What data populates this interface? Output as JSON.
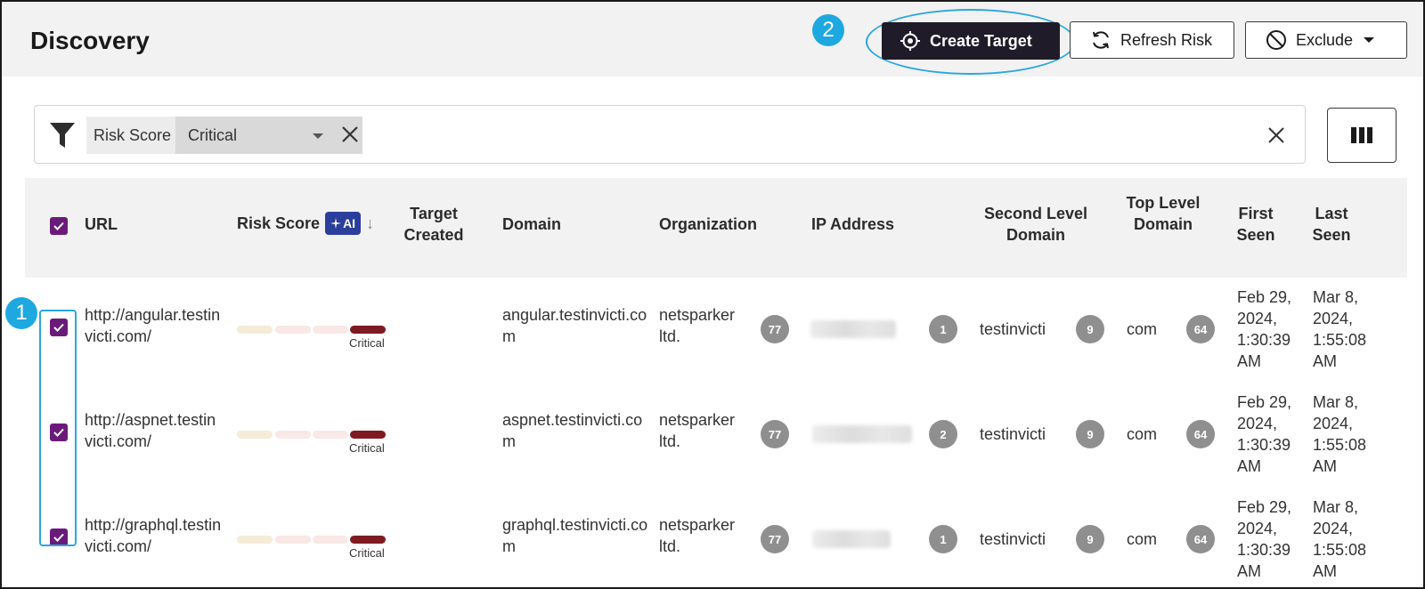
{
  "header": {
    "title": "Discovery",
    "create_target_label": "Create Target",
    "refresh_risk_label": "Refresh Risk",
    "exclude_label": "Exclude"
  },
  "callouts": [
    "1",
    "2"
  ],
  "filter": {
    "field_label": "Risk Score",
    "selected_value": "Critical"
  },
  "table": {
    "columns": {
      "url": "URL",
      "risk_score": "Risk Score",
      "ai_badge": "AI",
      "target_created": "Target Created",
      "domain": "Domain",
      "organization": "Organization",
      "ip_address": "IP Address",
      "second_level_domain": "Second Level Domain",
      "top_level_domain": "Top Level Domain",
      "first_seen": "First Seen",
      "last_seen": "Last Seen"
    },
    "rows": [
      {
        "checked": true,
        "url": "http://angular.testinvicti.com/",
        "risk_level": "Critical",
        "domain": "angular.testinvicti.com",
        "organization": "netsparker ltd.",
        "organization_count": "77",
        "ip_count": "1",
        "second_level_domain": "testinvicti",
        "sld_count": "9",
        "top_level_domain": "com",
        "tld_count": "64",
        "first_seen": "Feb 29, 2024, 1:30:39 AM",
        "last_seen": "Mar 8, 2024, 1:55:08 AM"
      },
      {
        "checked": true,
        "url": "http://aspnet.testinvicti.com/",
        "risk_level": "Critical",
        "domain": "aspnet.testinvicti.com",
        "organization": "netsparker ltd.",
        "organization_count": "77",
        "ip_count": "2",
        "second_level_domain": "testinvicti",
        "sld_count": "9",
        "top_level_domain": "com",
        "tld_count": "64",
        "first_seen": "Feb 29, 2024, 1:30:39 AM",
        "last_seen": "Mar 8, 2024, 1:55:08 AM"
      },
      {
        "checked": true,
        "url": "http://graphql.testinvicti.com/",
        "risk_level": "Critical",
        "domain": "graphql.testinvicti.com",
        "organization": "netsparker ltd.",
        "organization_count": "77",
        "ip_count": "1",
        "second_level_domain": "testinvicti",
        "sld_count": "9",
        "top_level_domain": "com",
        "tld_count": "64",
        "first_seen": "Feb 29, 2024, 1:30:39 AM",
        "last_seen": "Mar 8, 2024, 1:55:08 AM"
      }
    ]
  },
  "colors": {
    "primary_button": "#1f1b29",
    "checkbox": "#6a1b7a",
    "critical": "#7d1a22",
    "ai_badge": "#2c3e9c",
    "callout": "#1ea8e0"
  },
  "icons": {
    "create_target": "crosshair-icon",
    "refresh_risk": "refresh-icon",
    "exclude": "block-icon",
    "filter": "funnel-icon",
    "columns": "columns-icon"
  }
}
